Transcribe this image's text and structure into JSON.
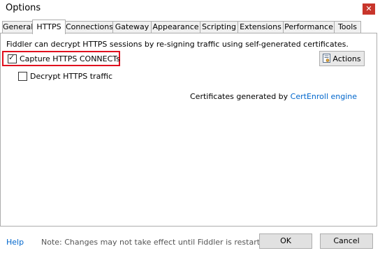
{
  "window": {
    "title": "Options",
    "close_glyph": "✕"
  },
  "tabs": [
    {
      "label": "General"
    },
    {
      "label": "HTTPS"
    },
    {
      "label": "Connections"
    },
    {
      "label": "Gateway"
    },
    {
      "label": "Appearance"
    },
    {
      "label": "Scripting"
    },
    {
      "label": "Extensions"
    },
    {
      "label": "Performance"
    },
    {
      "label": "Tools"
    }
  ],
  "active_tab": "HTTPS",
  "https": {
    "description": "Fiddler can decrypt HTTPS sessions by re-signing traffic using self-generated certificates.",
    "capture_label": "Capture HTTPS CONNECTs",
    "capture_checked": true,
    "decrypt_label": "Decrypt HTTPS traffic",
    "decrypt_checked": false,
    "actions_label": "Actions",
    "cert_prefix": "Certificates generated by",
    "cert_engine": "CertEnroll engine"
  },
  "footer": {
    "help_label": "Help",
    "note": "Note: Changes may not take effect until Fiddler is restarted.",
    "ok_label": "OK",
    "cancel_label": "Cancel"
  },
  "colors": {
    "highlight": "#e0101e",
    "link": "#0066cc",
    "close": "#c8352b"
  },
  "icons": {
    "close": "close-icon",
    "check": "checkmark-icon",
    "actions": "certificate-icon"
  }
}
